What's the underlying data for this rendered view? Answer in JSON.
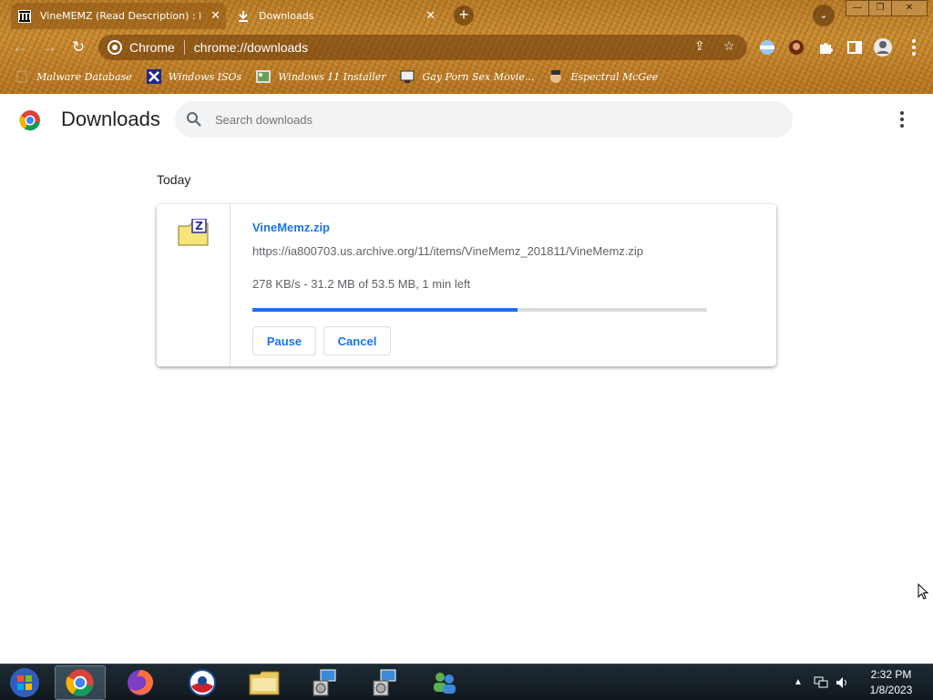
{
  "browser": {
    "tabs": [
      {
        "title": "VineMEMZ (Read Description) : F",
        "active": true
      },
      {
        "title": "Downloads",
        "active": false
      }
    ],
    "site_label": "Chrome",
    "url": "chrome://downloads"
  },
  "bookmarks": [
    {
      "label": "Malware Database"
    },
    {
      "label": "Windows ISOs"
    },
    {
      "label": "Windows 11 Installer"
    },
    {
      "label": "Gay Porn Sex Movie..."
    },
    {
      "label": "Espectral McGee"
    }
  ],
  "downloads_page": {
    "title": "Downloads",
    "search_placeholder": "Search downloads",
    "date_group": "Today",
    "item": {
      "filename": "VineMemz.zip",
      "url": "https://ia800703.us.archive.org/11/items/VineMemz_201811/VineMemz.zip",
      "status": "278 KB/s - 31.2 MB of 53.5 MB, 1 min left",
      "progress_fraction": 0.583,
      "pause_label": "Pause",
      "cancel_label": "Cancel"
    }
  },
  "taskbar": {
    "clock_time": "2:32 PM",
    "clock_date": "1/8/2023"
  },
  "colors": {
    "accent": "#1a73e8",
    "progress_track": "#dadce0"
  }
}
